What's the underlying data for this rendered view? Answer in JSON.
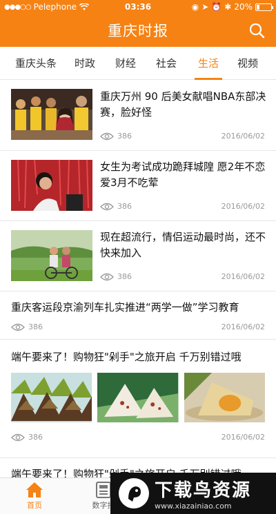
{
  "status": {
    "carrier": "Pelephone",
    "time": "03:36",
    "battery": "20%",
    "battery_level": 0.2
  },
  "header": {
    "title": "重庆时报",
    "search_icon": "search-icon"
  },
  "tabs": [
    {
      "label": "重庆头条"
    },
    {
      "label": "时政"
    },
    {
      "label": "财经"
    },
    {
      "label": "社会"
    },
    {
      "label": "生活",
      "active": true
    },
    {
      "label": "视频"
    }
  ],
  "feed": [
    {
      "headline": "重庆万州 90 后美女献唱NBA东部决赛，脸好怪",
      "views": "386",
      "date": "2016/06/02"
    },
    {
      "headline": "女生为考试成功跪拜城隍 愿2年不恋爱3月不吃荤",
      "views": "386",
      "date": "2016/06/02"
    },
    {
      "headline": "现在超流行，情侣运动最时尚，还不快来加入",
      "views": "386",
      "date": "2016/06/02"
    },
    {
      "headline": "重庆客运段京渝列车扎实推进“两学一做”学习教育",
      "views": "386",
      "date": "2016/06/02"
    },
    {
      "headline": "端午要来了！购物狂\"剁手\"之旅开启 千万别错过哦",
      "views": "386",
      "date": "2016/06/02"
    },
    {
      "headline": "端午要来了！购物狂\"剁手\"之旅开启 千万别错过哦"
    }
  ],
  "tabbar": [
    {
      "label": "首页",
      "active": true
    },
    {
      "label": "数字报"
    }
  ],
  "watermark": {
    "title": "下载鸟资源",
    "url": "www.xiazainiao.com"
  },
  "colors": {
    "accent": "#f68213"
  }
}
